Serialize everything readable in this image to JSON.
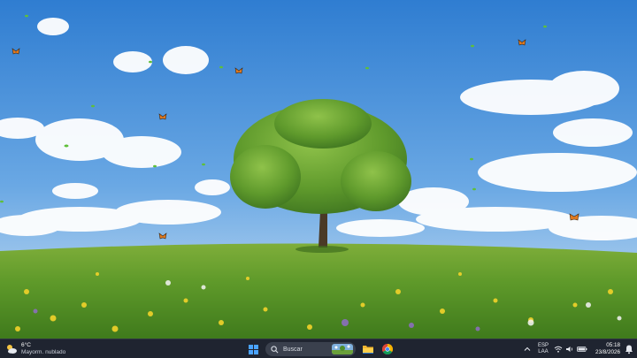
{
  "desktop": {
    "wallpaper": "meadow-tree-butterflies"
  },
  "taskbar": {
    "weather": {
      "icon": "partly-sunny-icon",
      "temperature": "6°C",
      "condition": "Mayorm. nublado"
    },
    "start": {
      "icon": "windows-logo-icon"
    },
    "search": {
      "placeholder": "Buscar",
      "icon": "search-icon"
    },
    "pinned": [
      {
        "name": "file-explorer",
        "icon": "folder-icon"
      },
      {
        "name": "chrome",
        "icon": "chrome-icon"
      }
    ],
    "tray": {
      "language_top": "ESP",
      "language_bottom": "LAA",
      "time": "05:18",
      "date": "23/8/2026"
    }
  },
  "colors": {
    "taskbar_bg": "#1f2430",
    "accent": "#4aa3ff"
  }
}
